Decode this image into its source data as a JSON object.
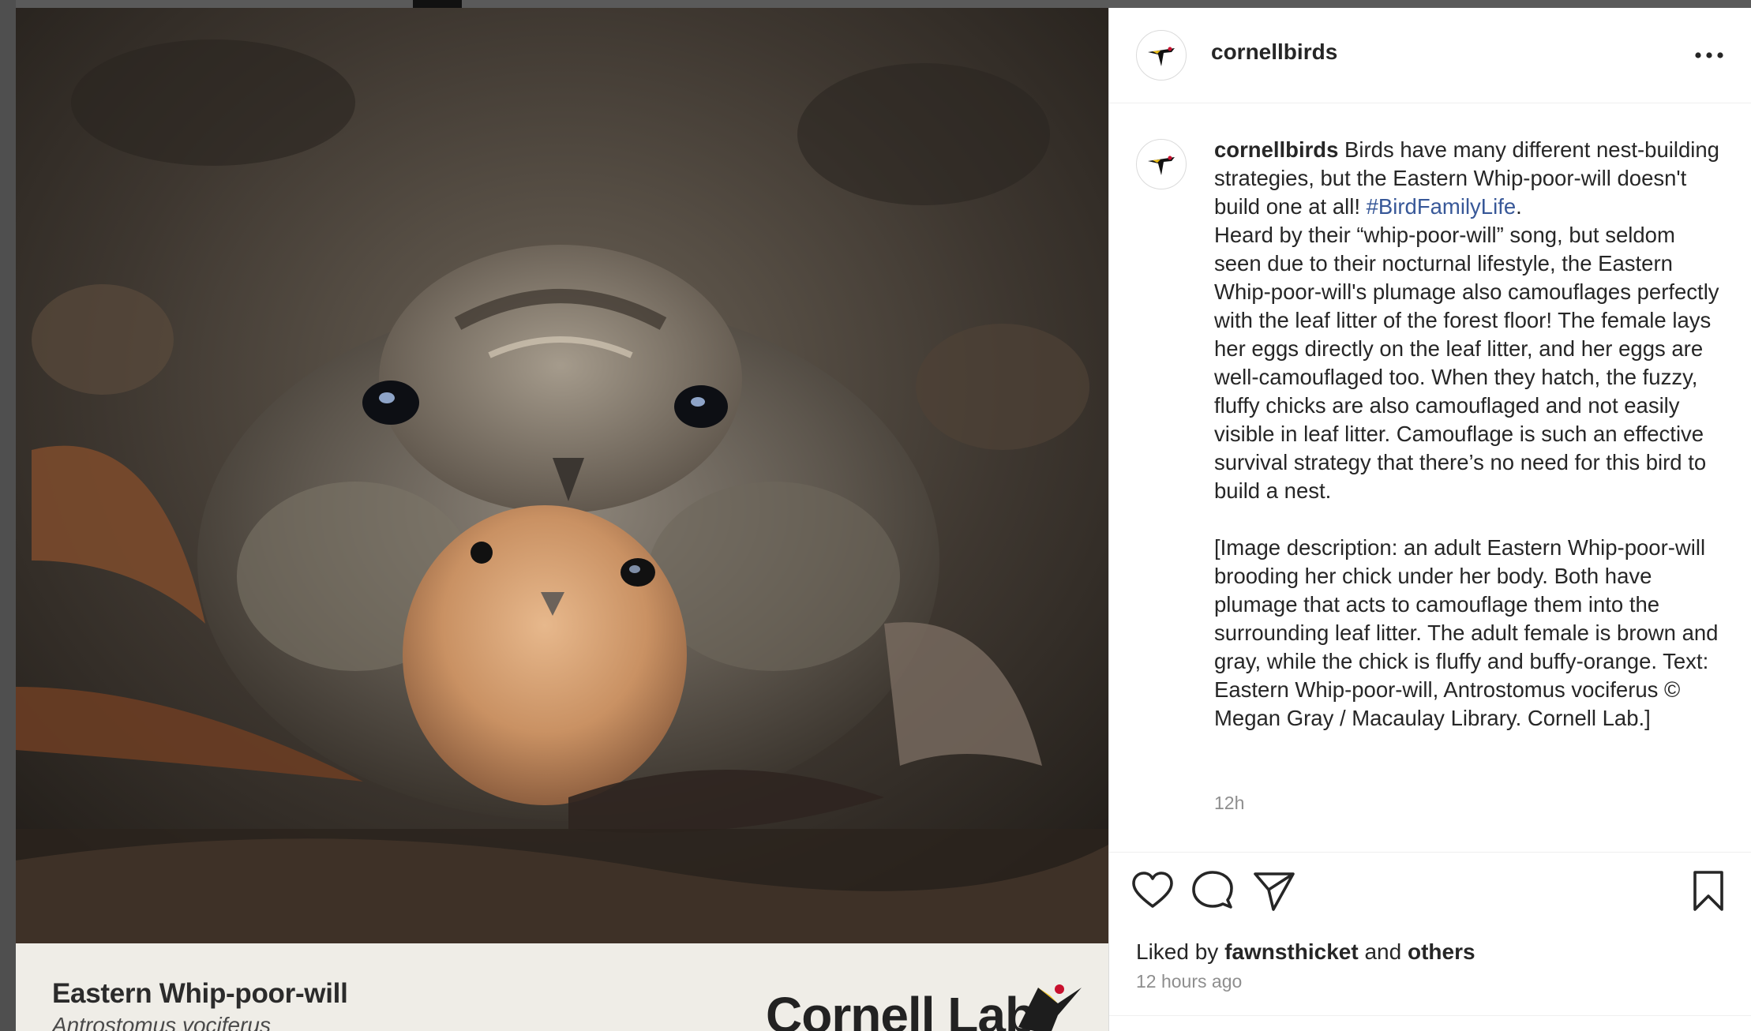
{
  "post": {
    "username": "cornellbirds",
    "more_icon": "more-horizontal-icon",
    "caption_prefix": "Birds have many different nest-building strategies, but the Eastern Whip-poor-will doesn't build one at all! ",
    "hashtag": "#BirdFamilyLife",
    "caption_rest": ".\nHeard by their “whip-poor-will” song, but seldom seen due to their nocturnal lifestyle, the Eastern Whip-poor-will's plumage also camouflages perfectly with the leaf litter of the forest floor! The female lays her eggs directly on the leaf litter, and her eggs are well-camouflaged too. When they hatch, the fuzzy, fluffy chicks are also camouflaged and not easily visible in leaf litter. Camouflage is such an effective survival strategy that there’s no need for this bird to build a nest.\n\n[Image description: an adult Eastern Whip-poor-will brooding her chick under her body. Both have plumage that acts to camouflage them into the surrounding leaf litter. The adult female is brown and gray, while the chick is fluffy and buffy-orange. Text: Eastern Whip-poor-will, Antrostomus vociferus © Megan Gray / Macaulay Library. Cornell Lab.]",
    "comment_time": "12h",
    "liked_by_prefix": "Liked by ",
    "liked_by_user": "fawnsthicket",
    "liked_by_mid": " and ",
    "liked_by_others": "others",
    "post_time": "12 hours ago"
  },
  "image": {
    "species_common": "Eastern Whip-poor-will",
    "species_scientific": "Antrostomus vociferus",
    "logo_text": "Cornell Lab"
  },
  "actions": {
    "like_icon": "heart-icon",
    "comment_icon": "comment-icon",
    "share_icon": "send-icon",
    "save_icon": "bookmark-icon"
  },
  "colors": {
    "hashtag": "#385898",
    "muted": "#8e8e8e",
    "text": "#262626"
  }
}
